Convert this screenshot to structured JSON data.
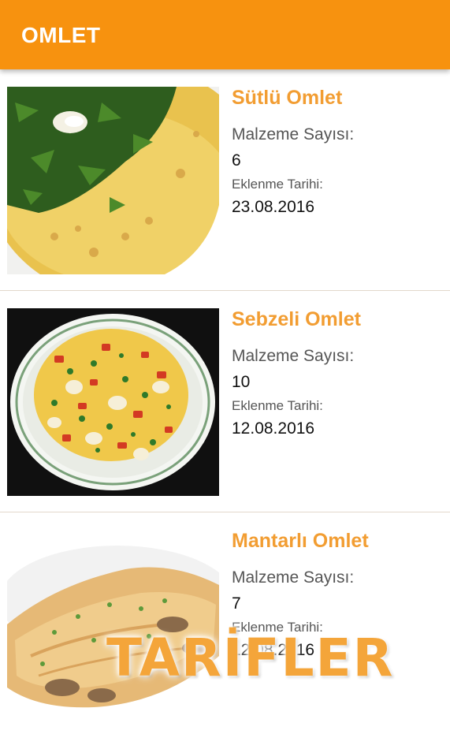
{
  "app_bar": {
    "title": "OMLET"
  },
  "recipes": [
    {
      "name": "Sütlü Omlet",
      "ingredient_label": "Malzeme Sayısı:",
      "ingredient_count": "6",
      "date_label": "Eklenme Tarihi:",
      "date": "23.08.2016",
      "image": "omelette-with-herbs-photo"
    },
    {
      "name": "Sebzeli Omlet",
      "ingredient_label": "Malzeme Sayısı:",
      "ingredient_count": "10",
      "date_label": "Eklenme Tarihi:",
      "date": "12.08.2016",
      "image": "vegetable-omelette-plate-photo"
    },
    {
      "name": "Mantarlı Omlet",
      "ingredient_label": "Malzeme Sayısı:",
      "ingredient_count": "7",
      "date_label": "Eklenme Tarihi:",
      "date": "12.08.2016",
      "image": "mushroom-omelette-photo"
    }
  ],
  "watermark": "TARİFLER",
  "colors": {
    "app_bar": "#f7920f",
    "recipe_title": "#f29d32",
    "divider": "#e3d8cc"
  }
}
